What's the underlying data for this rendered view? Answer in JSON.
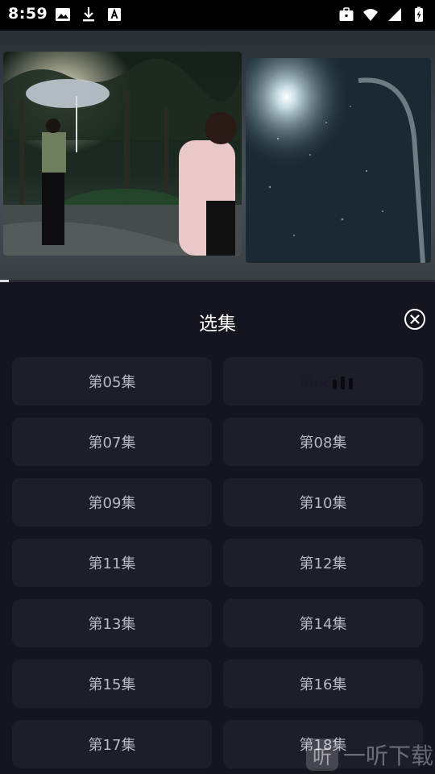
{
  "status_bar": {
    "time": "8:59",
    "left_icons": [
      "image-icon",
      "download-icon",
      "font-icon"
    ],
    "right_icons": [
      "briefcase-icon",
      "wifi-icon",
      "signal-icon",
      "battery-charging-icon"
    ]
  },
  "video": {
    "progress_fraction": 0.02
  },
  "sheet": {
    "title": "选集",
    "close_icon": "close-circle-icon"
  },
  "episodes": [
    {
      "label": "第05集",
      "playing": false
    },
    {
      "label": "第06集",
      "playing": true
    },
    {
      "label": "第07集",
      "playing": false
    },
    {
      "label": "第08集",
      "playing": false
    },
    {
      "label": "第09集",
      "playing": false
    },
    {
      "label": "第10集",
      "playing": false
    },
    {
      "label": "第11集",
      "playing": false
    },
    {
      "label": "第12集",
      "playing": false
    },
    {
      "label": "第13集",
      "playing": false
    },
    {
      "label": "第14集",
      "playing": false
    },
    {
      "label": "第15集",
      "playing": false
    },
    {
      "label": "第16集",
      "playing": false
    },
    {
      "label": "第17集",
      "playing": false
    },
    {
      "label": "第18集",
      "playing": false
    }
  ],
  "watermark": {
    "logo_text": "听",
    "text": "一听下载"
  },
  "colors": {
    "background": "#15151f",
    "episode_bg": "#1e1e2a",
    "episode_text": "#b8b8c4"
  }
}
